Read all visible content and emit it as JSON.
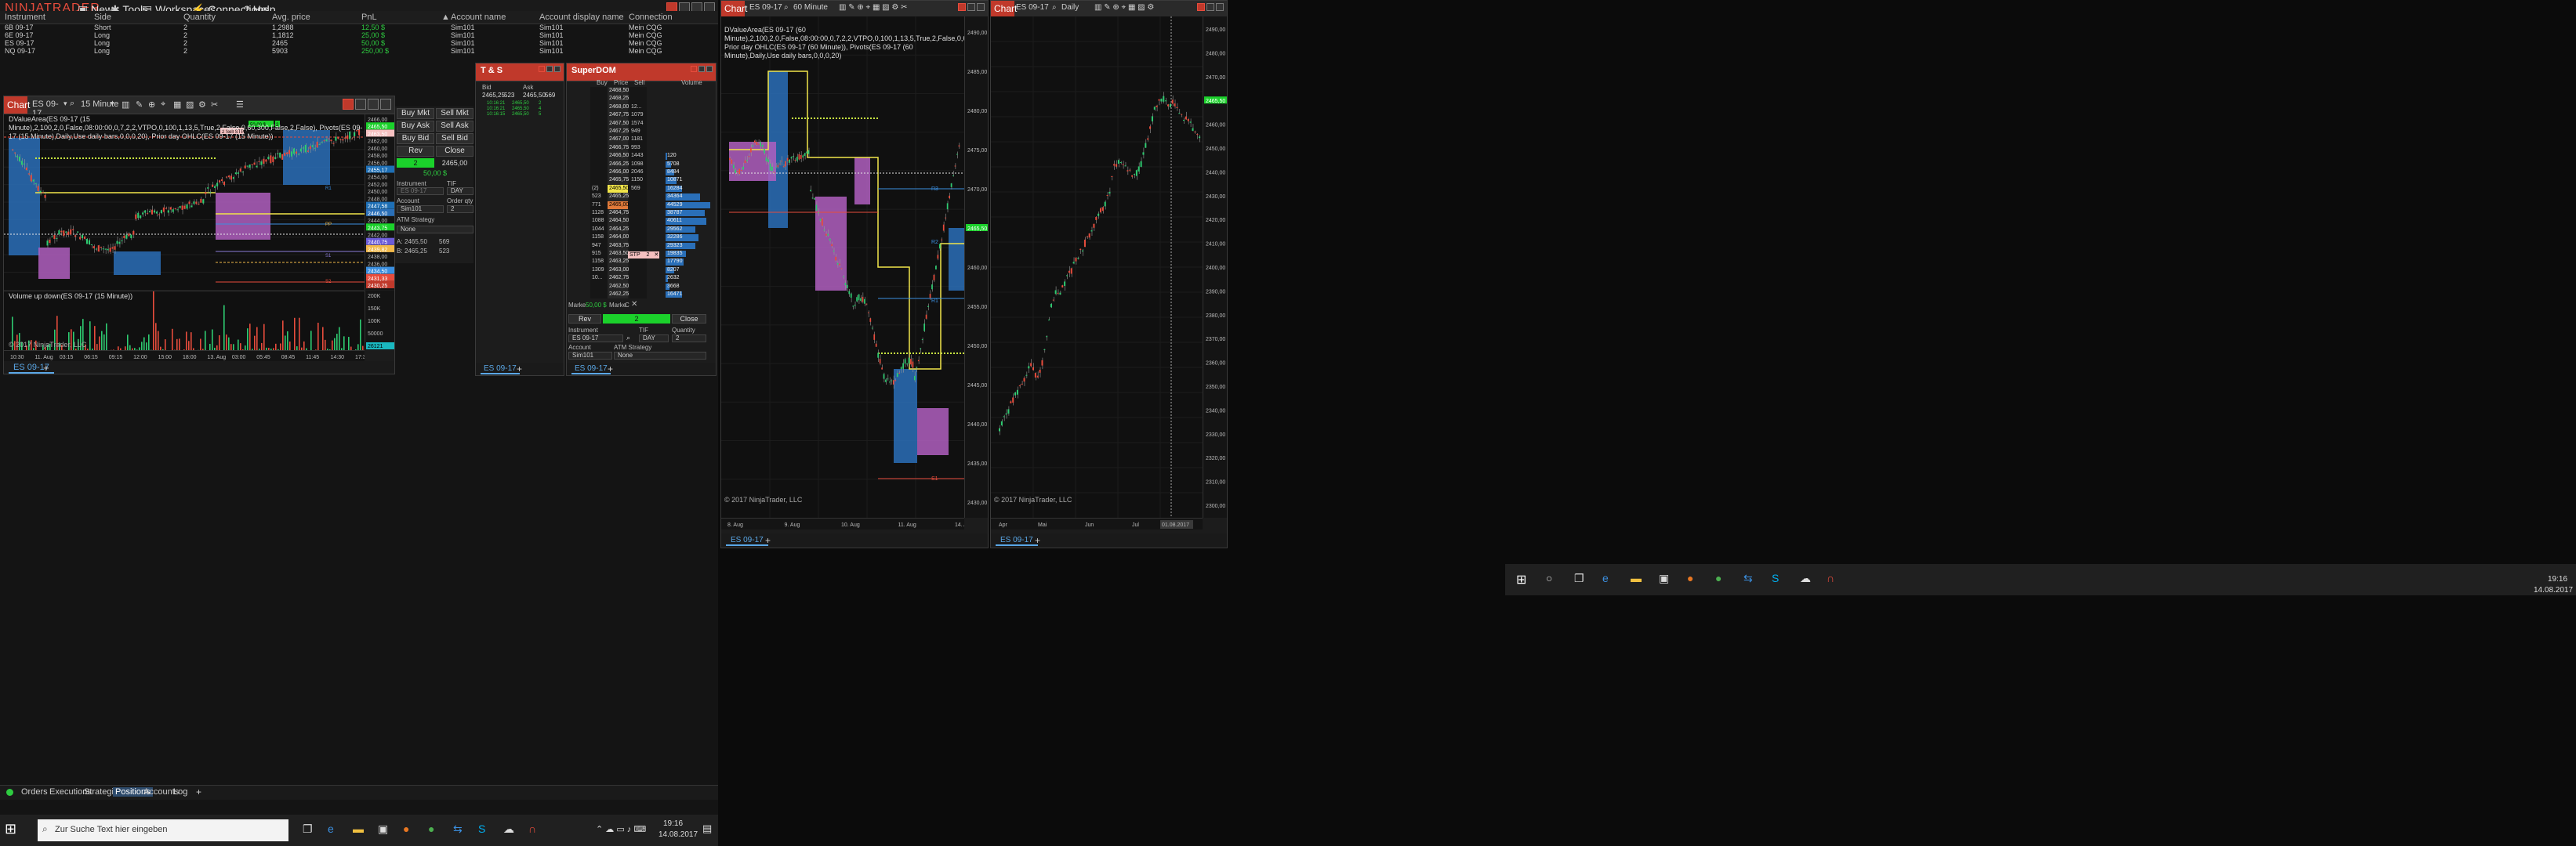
{
  "app": {
    "logo": "NINJATRADER",
    "menu": [
      "New",
      "Tools",
      "Workspaces",
      "Connections",
      "Help"
    ],
    "menu_icons": [
      "new-icon",
      "tools-icon",
      "workspaces-icon",
      "connections-icon",
      "help-icon"
    ]
  },
  "positions": {
    "headers": [
      "Instrument",
      "Side",
      "Quantity",
      "Avg. price",
      "PnL",
      "Account name",
      "Account display name",
      "Connection"
    ],
    "rows": [
      [
        "6B 09-17",
        "Short",
        "2",
        "1,2988",
        "12,50 $",
        "Sim101",
        "Sim101",
        "Mein CQG"
      ],
      [
        "6E 09-17",
        "Long",
        "2",
        "1,1812",
        "25,00 $",
        "Sim101",
        "Sim101",
        "Mein CQG"
      ],
      [
        "ES 09-17",
        "Long",
        "2",
        "2465",
        "50,00 $",
        "Sim101",
        "Sim101",
        "Mein CQG"
      ],
      [
        "NQ 09-17",
        "Long",
        "2",
        "5903",
        "250,00 $",
        "Sim101",
        "Sim101",
        "Mein CQG"
      ]
    ],
    "pnl_color": "#2ecc40"
  },
  "bottom_tabs": [
    "Orders",
    "Executions",
    "Strategies",
    "Positions",
    "Accounts",
    "Log"
  ],
  "bottom_tab_add": "+",
  "chart1": {
    "title": "Chart",
    "instrument": "ES 09-17",
    "interval": "15 Minute",
    "indicator_text": "DValueArea(ES 09-17 (15 Minute),2,100,2,0,False,08:00:00,0,7,2,2,VTPO,0,100,1,13,5,True,2,False,0,60,300,False,2,False), Pivots(ES 09-17 (15 Minute),Daily,Use daily bars,0,0,0,20), Prior day OHLC(ES 09-17 (15 Minute))",
    "price_labels": [
      "2466,00",
      "2465,50",
      "2463,50",
      "2462,00",
      "2460,00",
      "2458,00",
      "2456,00",
      "2455,17",
      "2454,00",
      "2452,00",
      "2450,00",
      "2448,00",
      "2447,58",
      "2446,50",
      "2444,00",
      "2443,75",
      "2442,00",
      "2440,75",
      "2439,82",
      "2438,00",
      "2436,00",
      "2434,50",
      "2431,33",
      "2430,25"
    ],
    "order_label": "2  Sell STP",
    "pnl_badge": "50,00 $",
    "pnl_qty": "2",
    "time_labels": [
      "10:30",
      "11. Aug",
      "03:15",
      "06:15",
      "09:15",
      "12:00",
      "15:00",
      "18:00",
      "13. Aug",
      "03:00",
      "05:45",
      "08:45",
      "11:45",
      "14:30",
      "17:30"
    ],
    "volume_title": "Volume up down(ES 09-17 (15 Minute))",
    "volume_labels": [
      "200K",
      "150K",
      "100K",
      "50000",
      "26121"
    ],
    "copyright": "© 2017 NinjaTrader, LLC",
    "pivot_labels": [
      "R1",
      "PP",
      "S1",
      "S2"
    ],
    "tab": "ES 09-17"
  },
  "chart_trader": {
    "buttons": [
      "Buy Mkt",
      "Sell Mkt",
      "Buy Ask",
      "Sell Ask",
      "Buy Bid",
      "Sell Bid",
      "Rev",
      "Close"
    ],
    "position_qty": "2",
    "position_price": "2465,00",
    "pnl": "50,00 $",
    "instrument_label": "Instrument",
    "tif_label": "TIF",
    "instrument": "ES 09-17",
    "tif": "DAY",
    "account_label": "Account",
    "order_qty_label": "Order qty",
    "account": "Sim101",
    "order_qty": "2",
    "atm_label": "ATM Strategy",
    "atm": "None",
    "ask_label": "A:",
    "ask_price": "2465,50",
    "ask_size": "569",
    "bid_label": "B:",
    "bid_price": "2465,25",
    "bid_size": "523"
  },
  "ts": {
    "title": "T & S",
    "bid_header": "Bid",
    "ask_header": "Ask",
    "bid": "2465,25",
    "bid_size": "523",
    "ask": "2465,50",
    "ask_size": "569",
    "rows": [
      [
        "10:16:21",
        "2465,50",
        "2"
      ],
      [
        "10:16:21",
        "2465,50",
        "4"
      ],
      [
        "10:16:15",
        "2465,50",
        "5"
      ]
    ],
    "tab": "ES 09-17"
  },
  "superdom": {
    "title": "SuperDOM",
    "headers": [
      "Buy",
      "Price",
      "Sell",
      "Volume"
    ],
    "ladder": [
      {
        "buy": "",
        "price": "2468,50",
        "sell": "",
        "vol": ""
      },
      {
        "buy": "",
        "price": "2468,25",
        "sell": "",
        "vol": ""
      },
      {
        "buy": "",
        "price": "2468,00",
        "sell": "12...",
        "vol": ""
      },
      {
        "buy": "",
        "price": "2467,75",
        "sell": "1079",
        "vol": ""
      },
      {
        "buy": "",
        "price": "2467,50",
        "sell": "1574",
        "vol": ""
      },
      {
        "buy": "",
        "price": "2467,25",
        "sell": "949",
        "vol": ""
      },
      {
        "buy": "",
        "price": "2467,00",
        "sell": "1181",
        "vol": ""
      },
      {
        "buy": "",
        "price": "2466,75",
        "sell": "993",
        "vol": ""
      },
      {
        "buy": "",
        "price": "2466,50",
        "sell": "1443",
        "vol": "120"
      },
      {
        "buy": "",
        "price": "2466,25",
        "sell": "1098",
        "vol": "5708"
      },
      {
        "buy": "",
        "price": "2466,00",
        "sell": "2046",
        "vol": "8484"
      },
      {
        "buy": "",
        "price": "2465,75",
        "sell": "1150",
        "vol": "10871"
      },
      {
        "buy": "(2)",
        "price": "2465,50",
        "sell": "569",
        "vol": "16284"
      },
      {
        "buy": "523",
        "price": "2465,25",
        "sell": "",
        "vol": "34364"
      },
      {
        "buy": "771",
        "price": "2465,00",
        "sell": "",
        "vol": "44529"
      },
      {
        "buy": "1128",
        "price": "2464,75",
        "sell": "",
        "vol": "38787"
      },
      {
        "buy": "1088",
        "price": "2464,50",
        "sell": "",
        "vol": "40611"
      },
      {
        "buy": "1044",
        "price": "2464,25",
        "sell": "",
        "vol": "29562"
      },
      {
        "buy": "1158",
        "price": "2464,00",
        "sell": "",
        "vol": "32286"
      },
      {
        "buy": "947",
        "price": "2463,75",
        "sell": "",
        "vol": "29323"
      },
      {
        "buy": "915",
        "price": "2463,50",
        "sell": "",
        "vol": "19835"
      },
      {
        "buy": "1158",
        "price": "2463,25",
        "sell": "",
        "vol": "17790"
      },
      {
        "buy": "1309",
        "price": "2463,00",
        "sell": "",
        "vol": "8207"
      },
      {
        "buy": "10...",
        "price": "2462,75",
        "sell": "",
        "vol": "2632"
      },
      {
        "buy": "",
        "price": "2462,50",
        "sell": "",
        "vol": "3668"
      },
      {
        "buy": "",
        "price": "2462,25",
        "sell": "",
        "vol": "16471"
      }
    ],
    "vol_max": 45000,
    "stp_label": "STP",
    "stp_qty": "2",
    "marke_left": "Marke",
    "pnl": "50,00 $",
    "marke_right": "Marke",
    "c_label": "C",
    "rev": "Rev",
    "qty": "2",
    "close": "Close",
    "instrument_label": "Instrument",
    "tif_label": "TIF",
    "quantity_label": "Quantity",
    "instrument": "ES 09-17",
    "tif": "DAY",
    "quantity": "2",
    "account_label": "Account",
    "atm_label": "ATM Strategy",
    "account": "Sim101",
    "atm": "None",
    "tab": "ES 09-17"
  },
  "chart2": {
    "title": "Chart",
    "instrument": "ES 09-17",
    "interval": "60 Minute",
    "indicator_text": "DValueArea(ES 09-17 (60 Minute),2,100,2,0,False,08:00:00,0,7,2,2,VTPO,0,100,1,13,5,True,2,False,0,60,300,False,2,False), Prior day OHLC(ES 09-17 (60 Minute)), Pivots(ES 09-17 (60 Minute),Daily,Use daily bars,0,0,0,20)",
    "price_labels": [
      "2490,00",
      "2485,00",
      "2480,00",
      "2475,00",
      "2470,00",
      "2465,50",
      "2460,00",
      "2455,00",
      "2450,00",
      "2445,00",
      "2440,00",
      "2435,00",
      "2430,00"
    ],
    "time_labels": [
      "8. Aug",
      "9. Aug",
      "10. Aug",
      "11. Aug",
      "14. Aug"
    ],
    "pivot_labels": [
      "R3",
      "R2",
      "R1",
      "S1"
    ],
    "copyright": "© 2017 NinjaTrader, LLC",
    "tab": "ES 09-17"
  },
  "chart3": {
    "title": "Chart",
    "instrument": "ES 09-17",
    "interval": "Daily",
    "price_labels": [
      "2490,00",
      "2480,00",
      "2470,00",
      "2465,50",
      "2460,00",
      "2450,00",
      "2440,00",
      "2430,00",
      "2420,00",
      "2410,00",
      "2400,00",
      "2390,00",
      "2380,00",
      "2370,00",
      "2360,00",
      "2350,00",
      "2340,00",
      "2330,00",
      "2320,00",
      "2310,00",
      "2300,00"
    ],
    "time_labels": [
      "Apr",
      "Mai",
      "Jun",
      "Jul",
      "01.08.2017"
    ],
    "copyright": "© 2017 NinjaTrader, LLC",
    "tab": "ES 09-17"
  },
  "taskbar_left": {
    "search_placeholder": "Zur Suche Text hier eingeben",
    "time": "19:16",
    "date": "14.08.2017"
  },
  "taskbar_right": {
    "time": "19:16",
    "date": "14.08.2017"
  },
  "colors": {
    "accent": "#2ecc40",
    "title_red": "#c0392b",
    "value_area": "#2a6fb8",
    "vtpo": "#b05fc0",
    "yellow": "#f1e54a",
    "sell_red": "#e74c3c",
    "blue_badge": "#1e6fb5"
  }
}
